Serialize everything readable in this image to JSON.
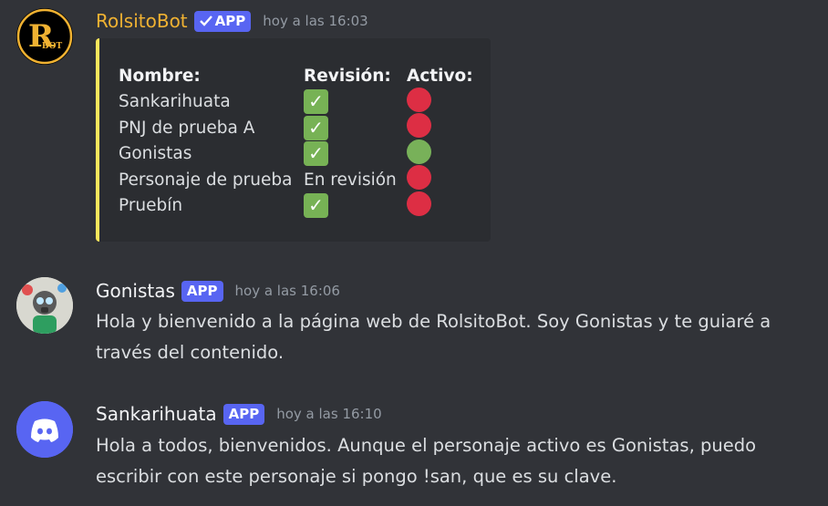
{
  "messages": [
    {
      "author": "RolsitoBot",
      "badge": "APP",
      "verified": true,
      "timestamp": "hoy a las 16:03",
      "avatar_text": "BOT",
      "avatar_logo": "R",
      "embed": {
        "accent_color": "#fee75c",
        "headers": [
          "Nombre:",
          "Revisión:",
          "Activo:"
        ],
        "rows": [
          {
            "name": "Sankarihuata",
            "revision": "check",
            "active": "red"
          },
          {
            "name": "PNJ de prueba A",
            "revision": "check",
            "active": "red"
          },
          {
            "name": "Gonistas",
            "revision": "check",
            "active": "green"
          },
          {
            "name": "Personaje de prueba",
            "revision": "En revisión",
            "active": "red"
          },
          {
            "name": "Pruebín",
            "revision": "check",
            "active": "red"
          }
        ]
      }
    },
    {
      "author": "Gonistas",
      "badge": "APP",
      "timestamp": "hoy a las 16:06",
      "content": "Hola y bienvenido a la página web de RolsitoBot. Soy Gonistas y te guiaré a través del contenido."
    },
    {
      "author": "Sankarihuata",
      "badge": "APP",
      "timestamp": "hoy a las 16:10",
      "content": "Hola a todos, bienvenidos. Aunque el personaje activo es Gonistas, puedo escribir con este personaje si pongo !san, que es su clave."
    }
  ],
  "colors": {
    "background": "#313338",
    "embed_bg": "#2b2d31",
    "badge": "#5865f2",
    "bot_name": "#f0b232",
    "check_green": "#77b255",
    "status_red": "#dd2e44",
    "status_green": "#78b159"
  },
  "icons": {
    "check": "white-check-mark-icon",
    "status_red": "red-circle-icon",
    "status_green": "green-circle-icon",
    "verified": "checkmark-icon",
    "discord": "discord-logo-icon"
  }
}
